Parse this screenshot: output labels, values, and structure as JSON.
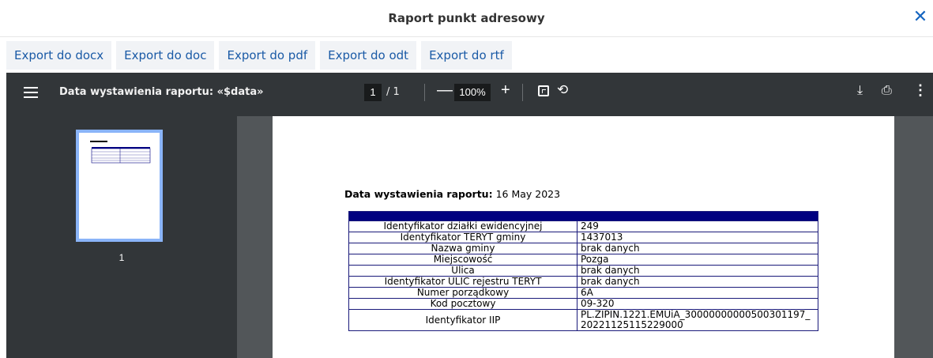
{
  "dialog": {
    "title": "Raport punkt adresowy",
    "close_glyph": "✕"
  },
  "exports": [
    {
      "label": "Export do docx"
    },
    {
      "label": "Export do doc"
    },
    {
      "label": "Export do pdf"
    },
    {
      "label": "Export do odt"
    },
    {
      "label": "Export do rtf"
    }
  ],
  "viewer": {
    "doc_title": "Data wystawienia raportu: «$data»",
    "page_current": "1",
    "page_total": "/ 1",
    "zoom": "100%",
    "thumb_page": "1"
  },
  "report": {
    "date_label": "Data wystawienia raportu:",
    "date_value": "16 May 2023",
    "rows": [
      {
        "label": "Identyfikator działki ewidencyjnej",
        "value": "249"
      },
      {
        "label": "Identyfikator TERYT gminy",
        "value": "1437013"
      },
      {
        "label": "Nazwa gminy",
        "value": "brak danych"
      },
      {
        "label": "Miejscowość",
        "value": "Pozga"
      },
      {
        "label": "Ulica",
        "value": "brak danych"
      },
      {
        "label": "Identyfikator ULIC rejestru TERYT",
        "value": "brak danych"
      },
      {
        "label": "Numer porządkowy",
        "value": "6A"
      },
      {
        "label": "Kod pocztowy",
        "value": "09-320"
      },
      {
        "label": "Identyfikator IIP",
        "value": "PL.ZIPIN.1221.EMUiA_30000000000500301197_\n20221125115229000"
      }
    ]
  }
}
